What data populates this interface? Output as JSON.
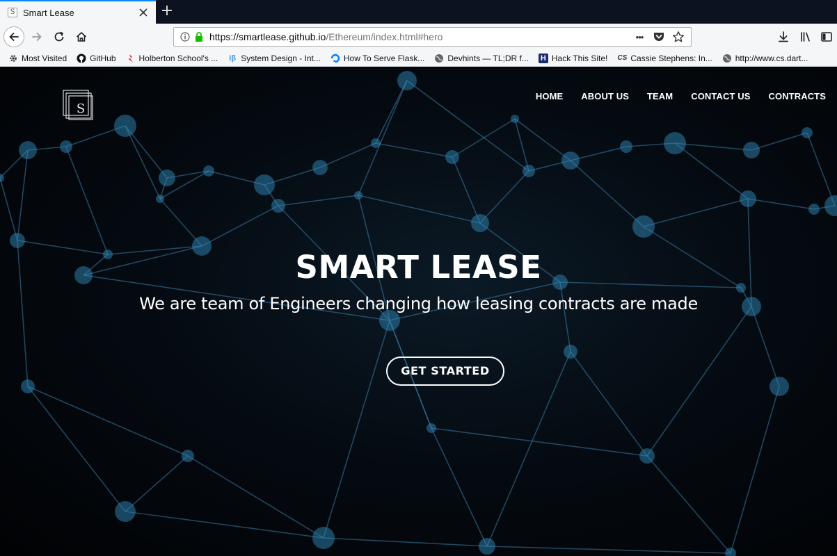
{
  "browser": {
    "tab_title": "Smart Lease",
    "tab_favicon_letter": "S",
    "new_tab_symbol": "+",
    "url_host": "https://smartlease.github.io",
    "url_path": "/Ethereum/index.html#hero",
    "page_actions_symbol": "•••"
  },
  "bookmarks": [
    {
      "label": "Most Visited",
      "icon": "gear-icon"
    },
    {
      "label": "GitHub",
      "icon": "github-icon"
    },
    {
      "label": "Holberton School's ...",
      "icon": "holberton-icon"
    },
    {
      "label": "System Design - Int...",
      "icon": "ib-icon",
      "glyph": "iβ"
    },
    {
      "label": "How To Serve Flask...",
      "icon": "digitalocean-icon"
    },
    {
      "label": "Devhints — TL;DR f...",
      "icon": "globe-icon"
    },
    {
      "label": "Hack This Site!",
      "icon": "hackthissite-icon",
      "glyph": "H"
    },
    {
      "label": "Cassie Stephens: In...",
      "icon": "cassie-icon",
      "glyph": "CS"
    },
    {
      "label": "http://www.cs.dart...",
      "icon": "globe-icon"
    }
  ],
  "site": {
    "logo_letter": "S",
    "nav": [
      "HOME",
      "ABOUT US",
      "TEAM",
      "CONTACT US",
      "CONTRACTS"
    ],
    "hero_title": "SMART LEASE",
    "hero_subtitle": "We are team of Engineers changing how leasing contracts are made",
    "cta_label": "GET STARTED"
  },
  "colors": {
    "accent": "#0a84ff",
    "network_line": "#3a7aa3",
    "network_node": "#2f87b8"
  }
}
